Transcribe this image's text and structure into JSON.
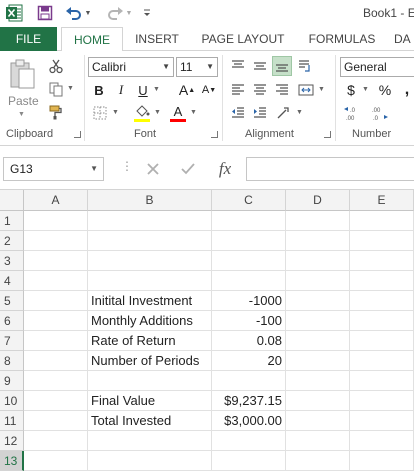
{
  "app": {
    "title": "Book1 - Ex",
    "icons": [
      "excel-logo-icon",
      "save-icon",
      "undo-icon",
      "redo-icon",
      "customize-qat-icon"
    ],
    "accent": "#217346"
  },
  "ribbon_tabs": [
    "FILE",
    "HOME",
    "INSERT",
    "PAGE LAYOUT",
    "FORMULAS",
    "DA"
  ],
  "active_tab": "HOME",
  "clipboard": {
    "label": "Clipboard",
    "paste_label": "Paste"
  },
  "font": {
    "label": "Font",
    "name": "Calibri",
    "size": "11",
    "bold": "B",
    "italic": "I",
    "underline": "U",
    "grow": "A",
    "shrink": "A",
    "color_letter": "A"
  },
  "alignment": {
    "label": "Alignment"
  },
  "number": {
    "label": "Number",
    "format": "General",
    "currency": "$",
    "percent": "%",
    "comma": ","
  },
  "formula_bar": {
    "name_box": "G13",
    "fx": "fx",
    "content": ""
  },
  "sheet": {
    "columns": [
      "A",
      "B",
      "C",
      "D",
      "E"
    ],
    "rows": [
      "1",
      "2",
      "3",
      "4",
      "5",
      "6",
      "7",
      "8",
      "9",
      "10",
      "11",
      "12",
      "13"
    ],
    "active_row": "13",
    "cells": {
      "B5": "Initital Investment",
      "C5": "-1000",
      "B6": "Monthly Additions",
      "C6": "-100",
      "B7": "Rate of Return",
      "C7": "0.08",
      "B8": "Number of Periods",
      "C8": "20",
      "B10": "Final Value",
      "C10": "$9,237.15",
      "B11": "Total Invested",
      "C11": "$3,000.00"
    }
  }
}
